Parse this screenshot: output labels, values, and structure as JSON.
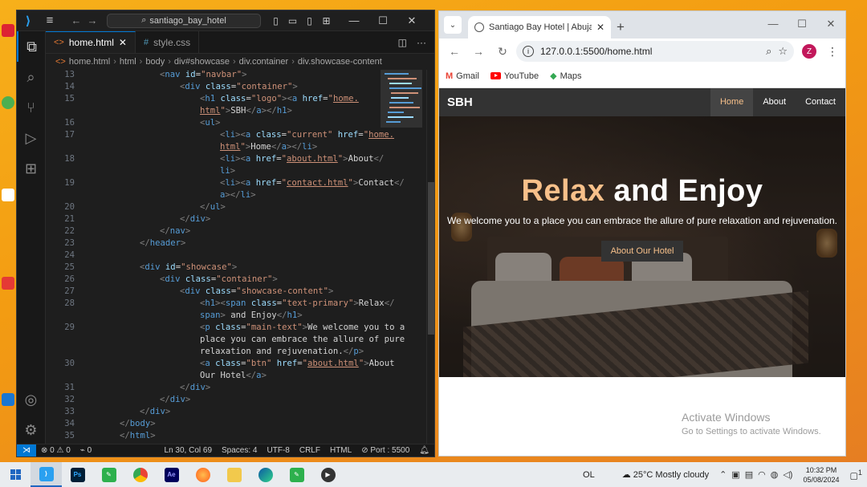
{
  "vscode": {
    "search_text": "santiago_bay_hotel",
    "tabs": [
      {
        "label": "home.html",
        "icon": "html-file-icon",
        "active": true
      },
      {
        "label": "style.css",
        "icon": "css-file-icon",
        "active": false
      }
    ],
    "breadcrumb": [
      "home.html",
      "html",
      "body",
      "div#showcase",
      "div.container",
      "div.showcase-content"
    ],
    "line_numbers": [
      "13",
      "14",
      "15",
      "",
      "16",
      "17",
      "",
      "18",
      "",
      "19",
      "",
      "20",
      "21",
      "22",
      "23",
      "24",
      "25",
      "26",
      "27",
      "28",
      "",
      "29",
      "",
      "",
      "30",
      "",
      "31",
      "32",
      "33",
      "34",
      "35"
    ],
    "status": {
      "errors": "0",
      "warnings": "0",
      "ports": "0",
      "position": "Ln 30, Col 69",
      "spaces": "Spaces: 4",
      "encoding": "UTF-8",
      "eol": "CRLF",
      "language": "HTML",
      "port": "Port : 5500"
    }
  },
  "browser": {
    "tab_title": "Santiago Bay Hotel | Abuja Hote",
    "url": "127.0.0.1:5500/home.html",
    "profile_initial": "Z",
    "bookmarks": [
      "Gmail",
      "YouTube",
      "Maps"
    ]
  },
  "site": {
    "logo": "SBH",
    "nav": [
      "Home",
      "About",
      "Contact"
    ],
    "title_primary": "Relax",
    "title_rest": " and Enjoy",
    "main_text": "We welcome you to a place you can embrace the allure of pure relaxation and rejuvenation.",
    "button": "About Our Hotel"
  },
  "watermark": {
    "line1": "Activate Windows",
    "line2": "Go to Settings to activate Windows."
  },
  "taskbar": {
    "apps": [
      "vscode-icon",
      "photoshop-icon",
      "app-green-icon",
      "chrome-icon",
      "after-effects-icon",
      "firefox-icon",
      "file-explorer-icon",
      "edge-icon",
      "app-green-icon",
      "media-player-icon"
    ],
    "ol_label": "OL",
    "weather": "25°C  Mostly cloudy",
    "time": "10:32 PM",
    "date": "05/08/2024",
    "notification_count": "1"
  },
  "colors": {
    "accent": "#0078d4",
    "site_primary": "#f7c08a",
    "site_header": "#333333"
  }
}
